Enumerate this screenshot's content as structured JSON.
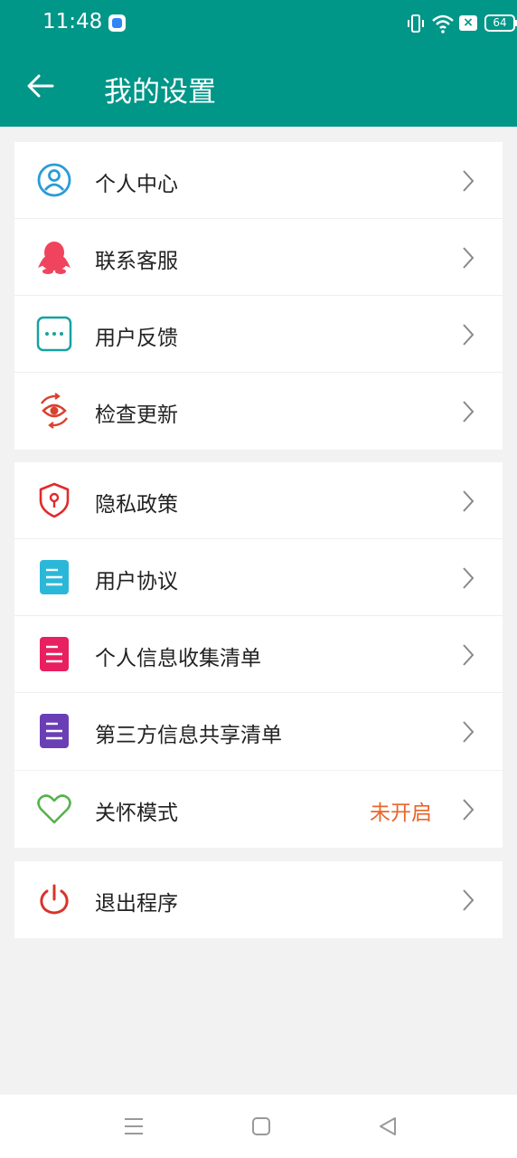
{
  "status_bar": {
    "time": "11:48",
    "battery": "64",
    "icons": [
      "app-icon",
      "vibrate-icon",
      "wifi-icon",
      "x-icon",
      "battery-icon"
    ]
  },
  "header": {
    "title": "我的设置",
    "back_icon": "arrow-left-icon",
    "color": "#009688"
  },
  "groups": [
    {
      "items": [
        {
          "label": "个人中心",
          "icon": "person-circle-icon",
          "color": "#2a9bd8"
        },
        {
          "label": "联系客服",
          "icon": "qq-penguin-icon",
          "color": "#f0445e"
        },
        {
          "label": "用户反馈",
          "icon": "chat-dots-icon",
          "color": "#17a2a0"
        },
        {
          "label": "检查更新",
          "icon": "eye-refresh-icon",
          "color": "#d9412e"
        }
      ]
    },
    {
      "items": [
        {
          "label": "隐私政策",
          "icon": "shield-keyhole-icon",
          "color": "#e02b2b"
        },
        {
          "label": "用户协议",
          "icon": "document-icon",
          "color": "#2bb8d8"
        },
        {
          "label": "个人信息收集清单",
          "icon": "document-icon",
          "color": "#e8205f"
        },
        {
          "label": "第三方信息共享清单",
          "icon": "document-icon",
          "color": "#6a3fb6"
        }
      ]
    },
    {
      "items": [
        {
          "label": "关怀模式",
          "value": "未开启",
          "icon": "heart-outline-icon",
          "color": "#55b34a"
        }
      ]
    },
    {
      "items": [
        {
          "label": "退出程序",
          "icon": "power-icon",
          "color": "#d9342b"
        }
      ]
    }
  ],
  "nav_bar": {
    "buttons": [
      "menu-icon",
      "home-square-icon",
      "back-triangle-icon"
    ]
  }
}
